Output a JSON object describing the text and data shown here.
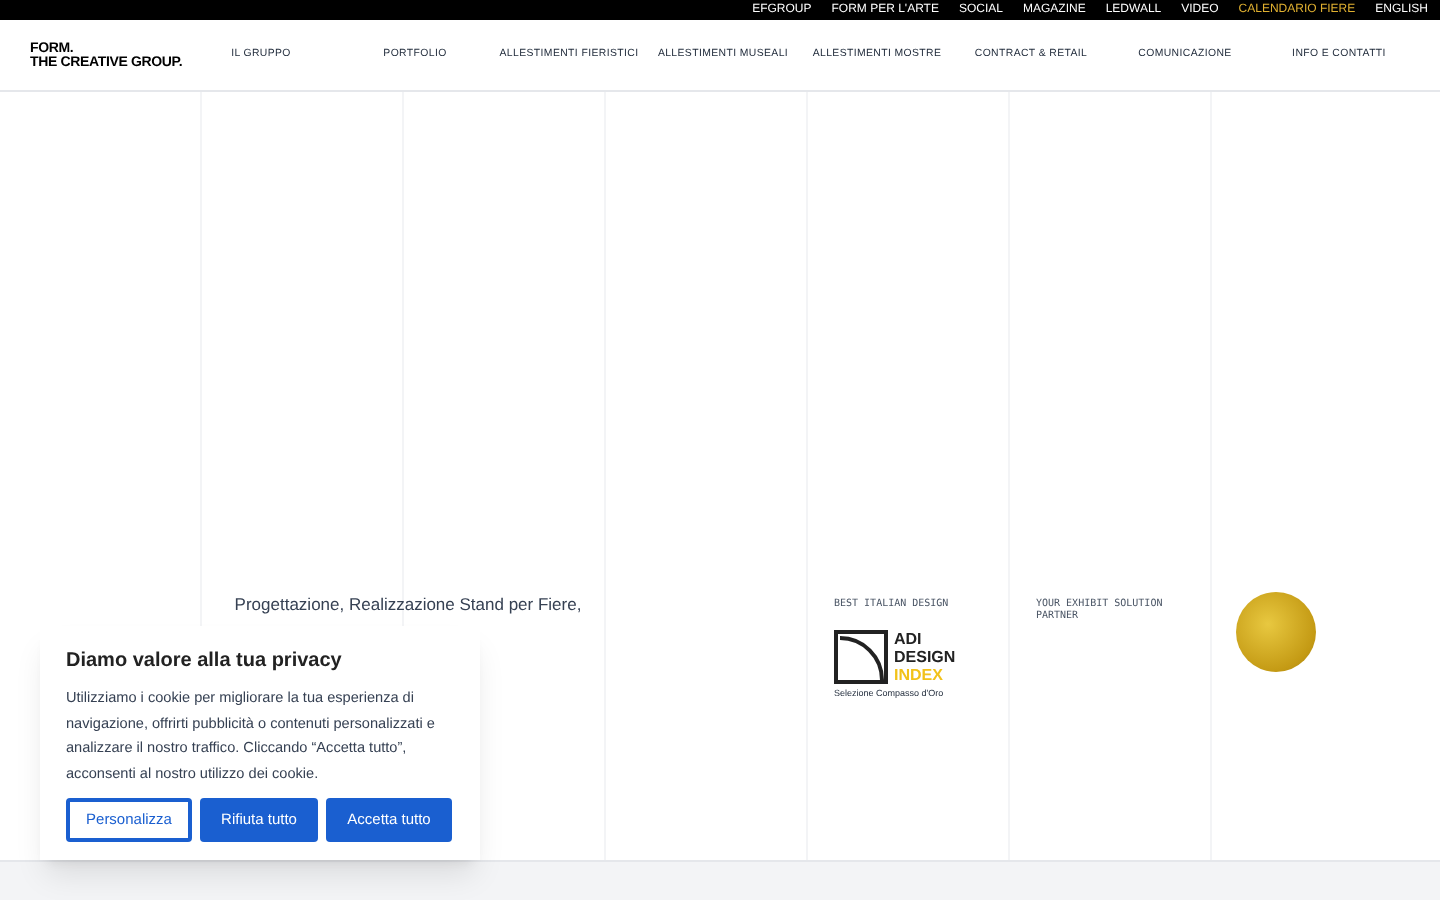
{
  "top_links": [
    {
      "label": "EFGROUP",
      "highlighted": false
    },
    {
      "label": "FORM PER L'ARTE",
      "highlighted": false
    },
    {
      "label": "SOCIAL",
      "highlighted": false
    },
    {
      "label": "MAGAZINE",
      "highlighted": false
    },
    {
      "label": "LEDWALL",
      "highlighted": false
    },
    {
      "label": "VIDEO",
      "highlighted": false
    },
    {
      "label": "CALENDARIO FIERE",
      "highlighted": true
    },
    {
      "label": "ENGLISH",
      "highlighted": false
    }
  ],
  "logo": [
    "FORM.",
    "THE CREATIVE GROUP."
  ],
  "nav": [
    "IL GRUPPO",
    "PORTFOLIO",
    "ALLESTIMENTI FIERISTICI",
    "ALLESTIMENTI MUSEALI",
    "ALLESTIMENTI MOSTRE",
    "CONTRACT & RETAIL",
    "COMUNICAZIONE",
    "INFO E CONTATTI"
  ],
  "tagline": "Progettazione, Realizzazione Stand per Fiere,",
  "award": {
    "caption": "BEST ITALIAN DESIGN",
    "logo_lines": [
      "ADI",
      "DESIGN",
      "INDEX"
    ],
    "subtitle": "Selezione Compasso d'Oro"
  },
  "partner": {
    "caption": "YOUR EXHIBIT SOLUTION PARTNER"
  },
  "cookie": {
    "title": "Diamo valore alla tua privacy",
    "text": "Utilizziamo i cookie per migliorare la tua esperienza di navigazione, offrirti pubblicità o contenuti personalizzati e analizzare il nostro traffico. Cliccando “Accetta tutto”, acconsenti al nostro utilizzo dei cookie.",
    "buttons": [
      {
        "label": "Personalizza",
        "kind": "outline"
      },
      {
        "label": "Rifiuta tutto",
        "kind": "solid"
      },
      {
        "label": "Accetta tutto",
        "kind": "solid"
      }
    ]
  }
}
